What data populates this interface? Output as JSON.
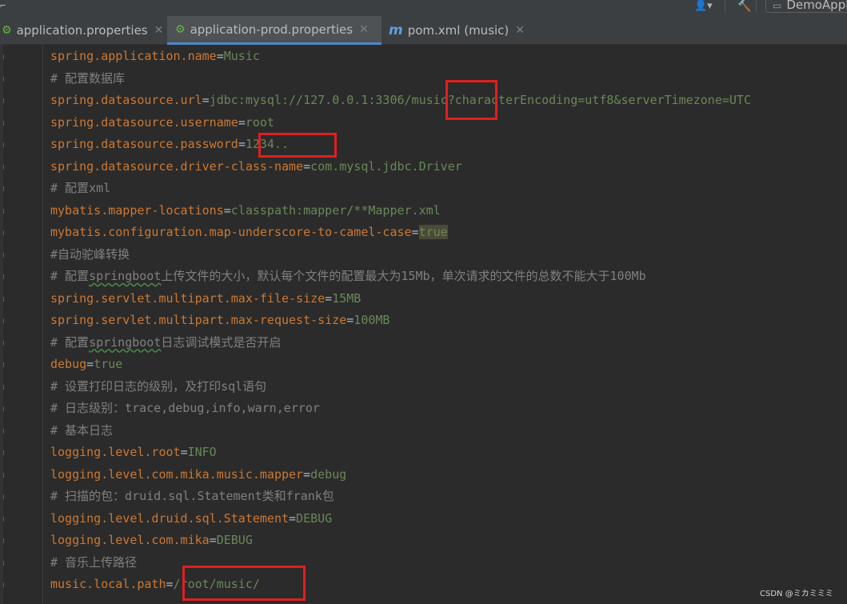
{
  "toolbar": {
    "run_config_label": "DemoApplication",
    "user_icon": "user-icon",
    "build_icon": "hammer-icon"
  },
  "tabs": [
    {
      "label": "application.properties",
      "icon": "properties-file-icon",
      "active": false
    },
    {
      "label": "application-prod.properties",
      "icon": "properties-file-icon",
      "active": true
    },
    {
      "label": "pom.xml (music)",
      "icon": "maven-icon",
      "active": false
    }
  ],
  "editor": {
    "lines": [
      {
        "key": "spring.application.name",
        "value": "Music"
      },
      {
        "comment": "# 配置数据库"
      },
      {
        "key": "spring.datasource.url",
        "value": "jdbc:mysql://127.0.0.1:3306/music?characterEncoding=utf8&serverTimezone=UTC"
      },
      {
        "key": "spring.datasource.username",
        "value": "root"
      },
      {
        "key": "spring.datasource.password",
        "value": "1234.."
      },
      {
        "key": "spring.datasource.driver-class-name",
        "value": "com.mysql.jdbc.Driver"
      },
      {
        "comment": "# 配置xml"
      },
      {
        "key": "mybatis.mapper-locations",
        "value": "classpath:mapper/**Mapper.xml"
      },
      {
        "key": "mybatis.configuration.map-underscore-to-camel-case",
        "value": "true"
      },
      {
        "comment": "#自动驼峰转换"
      },
      {
        "comment_pre": "# 配置",
        "comment_under": "springboot",
        "comment_post": "上传文件的大小，默认每个文件的配置最大为15Mb，单次请求的文件的总数不能大于100Mb"
      },
      {
        "key": "spring.servlet.multipart.max-file-size",
        "value": "15MB"
      },
      {
        "key": "spring.servlet.multipart.max-request-size",
        "value": "100MB"
      },
      {
        "comment_pre": "# 配置",
        "comment_under": "springboot",
        "comment_post": "日志调试模式是否开启"
      },
      {
        "key": "debug",
        "value": "true"
      },
      {
        "comment": "# 设置打印日志的级别，及打印sql语句"
      },
      {
        "comment": "# 日志级别：trace,debug,info,warn,error"
      },
      {
        "comment": "# 基本日志"
      },
      {
        "key": "logging.level.root",
        "value": "INFO"
      },
      {
        "key": "logging.level.com.mika.music.mapper",
        "value": "debug"
      },
      {
        "comment": "# 扫描的包：druid.sql.Statement类和frank包"
      },
      {
        "key": "logging.level.druid.sql.Statement",
        "value": "DEBUG"
      },
      {
        "key": "logging.level.com.mika",
        "value": "DEBUG"
      },
      {
        "comment": "# 音乐上传路径"
      },
      {
        "key": "music.local.path",
        "value": "/root/music/"
      }
    ]
  },
  "colors": {
    "editor_bg": "#2b2b2b",
    "key": "#cc7832",
    "value": "#6a8759",
    "comment": "#808080",
    "highlight_box": "#e11f1f",
    "active_tab_underline": "#4a88c7"
  },
  "watermark": "CSDN @ミカミミミ"
}
